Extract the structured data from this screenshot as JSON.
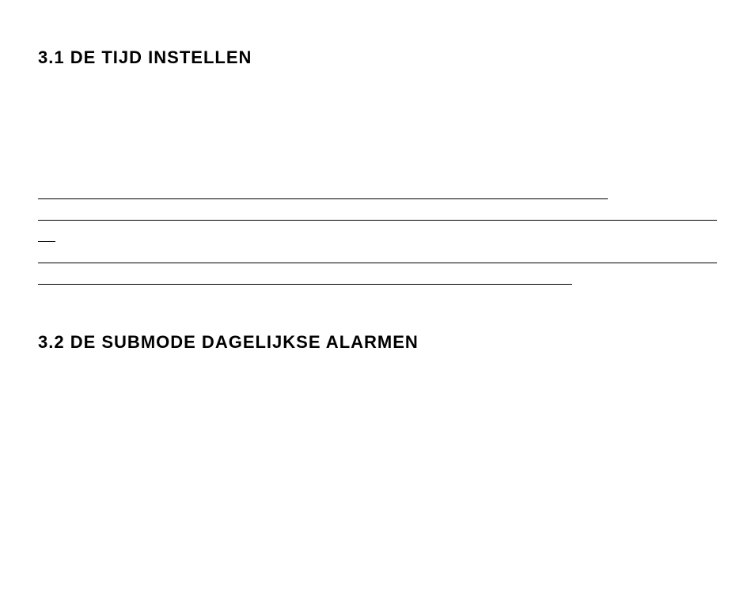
{
  "sections": {
    "heading1": "3.1 DE TIJD INSTELLEN",
    "heading2": "3.2 DE SUBMODE DAGELIJKSE ALARMEN"
  }
}
